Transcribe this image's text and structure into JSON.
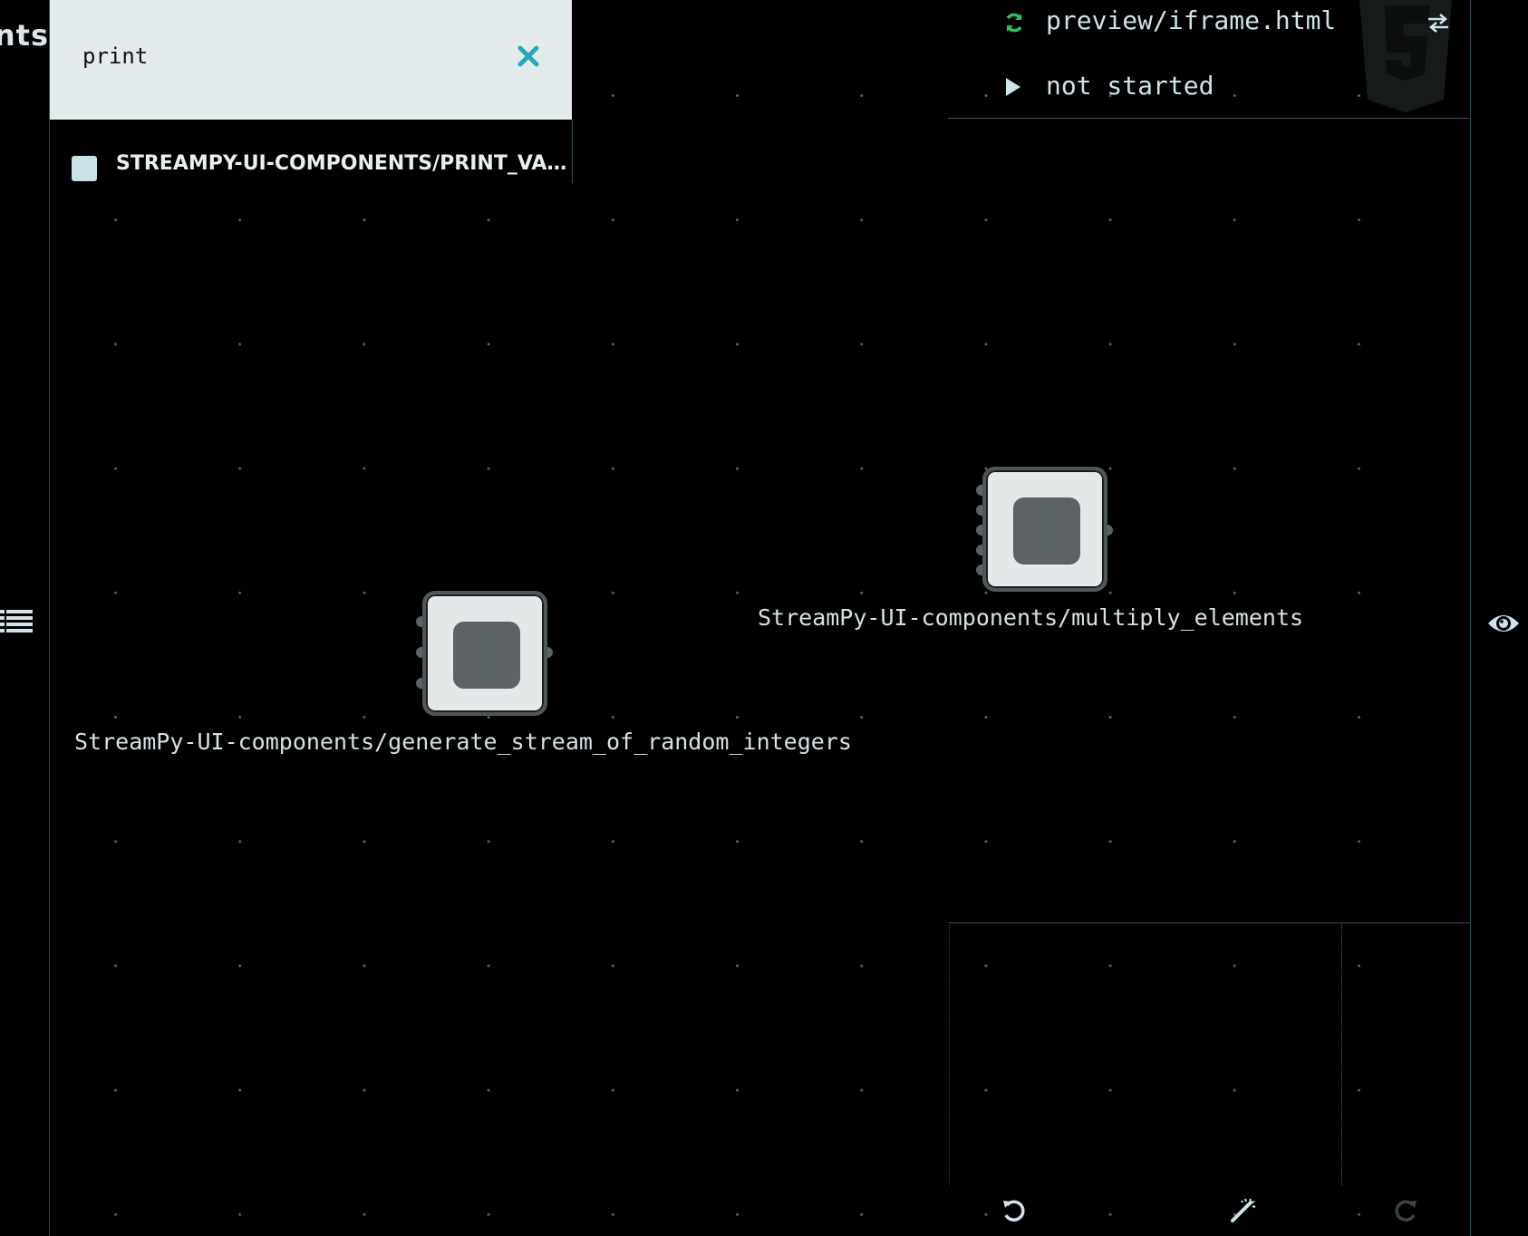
{
  "left_strip": {
    "title_fragment": "nts",
    "list_toggle_icon": "list-icon"
  },
  "search": {
    "query": "print",
    "clear_icon": "close-icon",
    "results": [
      {
        "label": "STREAMPY-UI-COMPONENTS/PRINT_VALU…"
      }
    ]
  },
  "nodes": [
    {
      "label": "StreamPy-UI-components/generate_stream_of_random_integers"
    },
    {
      "label": "StreamPy-UI-components/multiply_elements"
    }
  ],
  "preview": {
    "path": "preview/iframe.html",
    "status": "not started",
    "reload_icon": "refresh-icon",
    "swap_icon": "swap-icon",
    "play_icon": "play-icon",
    "logo": "html5-logo"
  },
  "toolbar": {
    "undo_icon": "undo-icon",
    "magic_icon": "magic-wand-icon",
    "redo_icon": "redo-icon"
  },
  "colors": {
    "background": "#000000",
    "panel_light": "#e3ebed",
    "accent_teal": "#2aa8b8",
    "reload_green": "#2fbf5c",
    "node_fill": "#e4e8e9",
    "node_inner": "#5b6366"
  }
}
